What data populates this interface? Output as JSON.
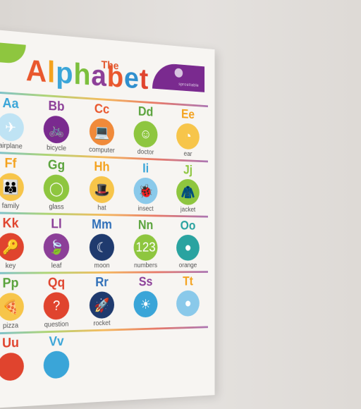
{
  "poster": {
    "title_small": "The",
    "title_big": [
      "A",
      "l",
      "p",
      "h",
      "a",
      "b",
      "e",
      "t"
    ],
    "brand": "sprouttable"
  },
  "rows": [
    [
      {
        "letters": "Aa",
        "word": "airplane",
        "icon": "globe-icon",
        "color": "#3aa5d8",
        "bg": "#bfe3f4",
        "glyph": "✈"
      },
      {
        "letters": "Bb",
        "word": "bicycle",
        "icon": "bicycle-icon",
        "color": "#8c3f98",
        "bg": "#7a2a8f",
        "glyph": "🚲"
      },
      {
        "letters": "Cc",
        "word": "computer",
        "icon": "computer-icon",
        "color": "#e9572d",
        "bg": "#f08a3a",
        "glyph": "💻"
      },
      {
        "letters": "Dd",
        "word": "doctor",
        "icon": "doctor-icon",
        "color": "#5aa33c",
        "bg": "#8ec63f",
        "glyph": "☺"
      },
      {
        "letters": "Ee",
        "word": "ear",
        "icon": "ear-icon",
        "color": "#f4a21e",
        "bg": "#f7c54a",
        "glyph": "◔"
      }
    ],
    [
      {
        "letters": "Ff",
        "word": "family",
        "icon": "family-icon",
        "color": "#f4a21e",
        "bg": "#f7c54a",
        "glyph": "👪"
      },
      {
        "letters": "Gg",
        "word": "glass",
        "icon": "glass-icon",
        "color": "#5aa33c",
        "bg": "#8ec63f",
        "glyph": "◯"
      },
      {
        "letters": "Hh",
        "word": "hat",
        "icon": "hat-icon",
        "color": "#f4a21e",
        "bg": "#f7c54a",
        "glyph": "🎩"
      },
      {
        "letters": "Ii",
        "word": "insect",
        "icon": "insect-icon",
        "color": "#3aa5d8",
        "bg": "#8ac9ea",
        "glyph": "🐞"
      },
      {
        "letters": "Jj",
        "word": "jacket",
        "icon": "jacket-icon",
        "color": "#8ec63f",
        "bg": "#8ec63f",
        "glyph": "🧥"
      }
    ],
    [
      {
        "letters": "Kk",
        "word": "key",
        "icon": "key-icon",
        "color": "#e0442e",
        "bg": "#e0442e",
        "glyph": "🔑"
      },
      {
        "letters": "Ll",
        "word": "leaf",
        "icon": "leaf-icon",
        "color": "#8c3f98",
        "bg": "#8c3f98",
        "glyph": "🍃"
      },
      {
        "letters": "Mm",
        "word": "moon",
        "icon": "moon-icon",
        "color": "#2f6fb8",
        "bg": "#1f3a6e",
        "glyph": "☾"
      },
      {
        "letters": "Nn",
        "word": "numbers",
        "icon": "numbers-icon",
        "color": "#5aa33c",
        "bg": "#8ec63f",
        "glyph": "123"
      },
      {
        "letters": "Oo",
        "word": "orange",
        "icon": "orange-icon",
        "color": "#2aa3a0",
        "bg": "#2aa3a0",
        "glyph": "●"
      }
    ],
    [
      {
        "letters": "Pp",
        "word": "pizza",
        "icon": "pizza-icon",
        "color": "#5aa33c",
        "bg": "#f7c54a",
        "glyph": "🍕"
      },
      {
        "letters": "Qq",
        "word": "question",
        "icon": "question-icon",
        "color": "#e0442e",
        "bg": "#e0442e",
        "glyph": "?"
      },
      {
        "letters": "Rr",
        "word": "rocket",
        "icon": "rocket-icon",
        "color": "#2f6fb8",
        "bg": "#1f3a6e",
        "glyph": "🚀"
      },
      {
        "letters": "Ss",
        "word": "",
        "icon": "sun-icon",
        "color": "#8c3f98",
        "bg": "#3aa5d8",
        "glyph": "☀"
      },
      {
        "letters": "Tt",
        "word": "",
        "icon": "tree-icon",
        "color": "#f4a21e",
        "bg": "#8ac9ea",
        "glyph": "●"
      }
    ],
    [
      {
        "letters": "Uu",
        "word": "",
        "icon": "umbrella-icon",
        "color": "#e0442e",
        "bg": "#e0442e",
        "glyph": ""
      },
      {
        "letters": "Vv",
        "word": "",
        "icon": "van-icon",
        "color": "#3aa5d8",
        "bg": "#3aa5d8",
        "glyph": ""
      }
    ]
  ]
}
